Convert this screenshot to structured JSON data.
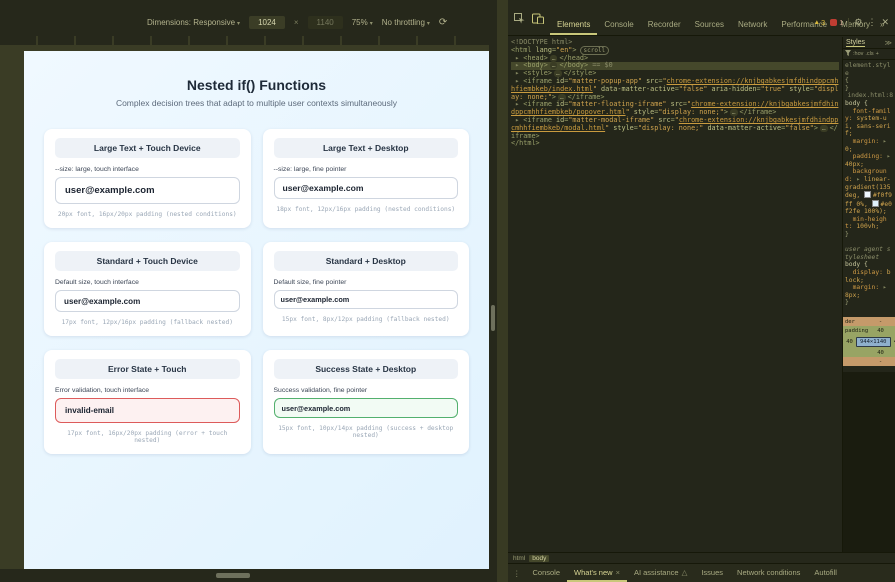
{
  "colors": {
    "page_gradient_start": "#f0f9ff",
    "page_gradient_end": "#e0f2fe",
    "error_red": "#dd5b5b",
    "success_green": "#53b06e",
    "devtools_accent": "#c9c77a"
  },
  "device_toolbar": {
    "dimensions_label": "Dimensions: Responsive",
    "caret": "▾",
    "width_value": "1024",
    "multiply": "×",
    "height_value": "1140",
    "zoom_value": "75%",
    "throttling_value": "No throttling",
    "rotate_glyph": "⟳"
  },
  "page": {
    "title": "Nested if() Functions",
    "subtitle": "Complex decision trees that adapt to multiple user contexts simultaneously",
    "cards": [
      {
        "header": "Large Text + Touch Device",
        "label": "--size: large, touch interface",
        "value": "user@example.com",
        "caption": "20px font, 16px/20px padding (nested conditions)"
      },
      {
        "header": "Large Text + Desktop",
        "label": "--size: large, fine pointer",
        "value": "user@example.com",
        "caption": "18px font, 12px/16px padding (nested conditions)"
      },
      {
        "header": "Standard + Touch Device",
        "label": "Default size, touch interface",
        "value": "user@example.com",
        "caption": "17px font, 12px/16px padding (fallback nested)"
      },
      {
        "header": "Standard + Desktop",
        "label": "Default size, fine pointer",
        "value": "user@example.com",
        "caption": "15px font, 8px/12px padding (fallback nested)"
      },
      {
        "header": "Error State + Touch",
        "label": "Error validation, touch interface",
        "value": "invalid-email",
        "caption": "17px font, 16px/20px padding (error + touch nested)"
      },
      {
        "header": "Success State + Desktop",
        "label": "Success validation, fine pointer",
        "value": "user@example.com",
        "caption": "15px font, 10px/14px padding (success + desktop nested)"
      }
    ]
  },
  "devtools": {
    "tabs": [
      "Elements",
      "Console",
      "Recorder",
      "Sources",
      "Network",
      "Performance",
      "Memory"
    ],
    "more_tabs": "»",
    "warn_glyph": "▲",
    "warning_count": "3",
    "error_count": "1",
    "gear": "⚙",
    "menu_dots": "⋮",
    "close": "✕",
    "dom_lines": [
      {
        "segs": [
          [
            "gray",
            "<!DOCTYPE html>"
          ]
        ]
      },
      {
        "segs": [
          [
            "tag",
            "<html"
          ],
          [
            "attr",
            " lang"
          ],
          [
            "tag",
            "="
          ],
          [
            "val",
            "\"en\""
          ],
          [
            "tag",
            ">"
          ],
          [
            "badge",
            "scroll"
          ]
        ]
      },
      {
        "segs": [
          [
            "arr",
            " ▸ "
          ],
          [
            "tag",
            "<head>"
          ],
          [
            "ell",
            "…"
          ],
          [
            "tag",
            "</head>"
          ]
        ]
      },
      {
        "sel": true,
        "segs": [
          [
            "arr",
            " ▸ "
          ],
          [
            "tag",
            "<body>"
          ],
          [
            "ell",
            "…"
          ],
          [
            "tag",
            "</body>"
          ],
          [
            "gray",
            " == $0"
          ]
        ]
      },
      {
        "segs": [
          [
            "arr",
            " ▸ "
          ],
          [
            "tag",
            "<style>"
          ],
          [
            "ell",
            "…"
          ],
          [
            "tag",
            "</style>"
          ]
        ]
      },
      {
        "segs": [
          [
            "arr",
            " ▸ "
          ],
          [
            "tag",
            "<iframe"
          ],
          [
            "attr",
            " id"
          ],
          [
            "tag",
            "="
          ],
          [
            "val",
            "\"matter-popup-app\""
          ],
          [
            "attr",
            " src"
          ],
          [
            "tag",
            "="
          ],
          [
            "val",
            "\""
          ],
          [
            "link",
            "chrome-extension://knjbgabkesjmfdhindppcmhhfiembkeb/index.html"
          ],
          [
            "val",
            "\""
          ],
          [
            "attr",
            " data-matter-active"
          ],
          [
            "tag",
            "="
          ],
          [
            "val",
            "\"false\""
          ],
          [
            "attr",
            " aria-hidden"
          ],
          [
            "tag",
            "="
          ],
          [
            "val",
            "\"true\""
          ],
          [
            "attr",
            " style"
          ],
          [
            "tag",
            "="
          ],
          [
            "val",
            "\"display: none;\""
          ],
          [
            "tag",
            ">"
          ],
          [
            "ell",
            "…"
          ],
          [
            "tag",
            "</iframe>"
          ]
        ]
      },
      {
        "segs": [
          [
            "arr",
            " ▸ "
          ],
          [
            "tag",
            "<iframe"
          ],
          [
            "attr",
            " id"
          ],
          [
            "tag",
            "="
          ],
          [
            "val",
            "\"matter-floating-iframe\""
          ],
          [
            "attr",
            " src"
          ],
          [
            "tag",
            "="
          ],
          [
            "val",
            "\""
          ],
          [
            "link",
            "chrome-extension://knjbgabkesjmfdhindppcmhhfiembkeb/popover.html"
          ],
          [
            "val",
            "\""
          ],
          [
            "attr",
            " style"
          ],
          [
            "tag",
            "="
          ],
          [
            "val",
            "\"display: none;\""
          ],
          [
            "tag",
            ">"
          ],
          [
            "ell",
            "…"
          ],
          [
            "tag",
            "</iframe>"
          ]
        ]
      },
      {
        "segs": [
          [
            "arr",
            " ▸ "
          ],
          [
            "tag",
            "<iframe"
          ],
          [
            "attr",
            " id"
          ],
          [
            "tag",
            "="
          ],
          [
            "val",
            "\"matter-modal-iframe\""
          ],
          [
            "attr",
            " src"
          ],
          [
            "tag",
            "="
          ],
          [
            "val",
            "\""
          ],
          [
            "link",
            "chrome-extension://knjbgabkesjmfdhindppcmhhfiembkeb/modal.html"
          ],
          [
            "val",
            "\""
          ],
          [
            "attr",
            " style"
          ],
          [
            "tag",
            "="
          ],
          [
            "val",
            "\"display: none;\""
          ],
          [
            "attr",
            " data-matter-active"
          ],
          [
            "tag",
            "="
          ],
          [
            "val",
            "\"false\""
          ],
          [
            "tag",
            ">"
          ],
          [
            "ell",
            "…"
          ],
          [
            "tag",
            "</iframe>"
          ]
        ]
      },
      {
        "segs": [
          [
            "tag",
            "</html>"
          ]
        ]
      }
    ],
    "styles_panel": {
      "title": "Styles",
      "more": "≫",
      "pseudo": ":hov",
      "cls": ".cls",
      "add": "+",
      "lines": [
        {
          "segs": [
            [
              "meta",
              "element.style"
            ]
          ]
        },
        {
          "segs": [
            [
              "pun",
              "{"
            ]
          ]
        },
        {
          "segs": [
            [
              "pun",
              "}"
            ]
          ]
        },
        {
          "segs": [
            [
              "rlink",
              "index.html:8"
            ]
          ]
        },
        {
          "segs": [
            [
              "sel",
              "body {"
            ]
          ]
        },
        {
          "segs": [
            [
              "prop",
              "  font-family:"
            ],
            [
              "val",
              " system-ui, sans-serif;"
            ]
          ]
        },
        {
          "segs": [
            [
              "prop",
              "  margin:"
            ],
            [
              "arr",
              " ▸"
            ],
            [
              "val",
              " 0;"
            ]
          ]
        },
        {
          "segs": [
            [
              "prop",
              "  padding:"
            ],
            [
              "arr",
              " ▸"
            ],
            [
              "val",
              " 40px;"
            ]
          ]
        },
        {
          "segs": [
            [
              "prop",
              "  background:"
            ],
            [
              "arr",
              " ▸"
            ],
            [
              "val",
              " linear-gradient(135deg, "
            ],
            [
              "swatch",
              "#f0f9ff"
            ],
            [
              "val",
              "#f0f9ff 0%, "
            ],
            [
              "swatch",
              "#e0f2fe"
            ],
            [
              "val",
              "#e0f2fe 100%);"
            ]
          ]
        },
        {
          "segs": [
            [
              "prop",
              "  min-height:"
            ],
            [
              "val",
              " 100vh;"
            ]
          ]
        },
        {
          "segs": [
            [
              "pun",
              "}"
            ]
          ]
        },
        {
          "segs": [
            [
              "sp",
              " "
            ]
          ]
        },
        {
          "segs": [
            [
              "metai",
              "user agent stylesheet"
            ]
          ]
        },
        {
          "segs": [
            [
              "sel",
              "body {"
            ]
          ]
        },
        {
          "segs": [
            [
              "prop",
              "  display:"
            ],
            [
              "val",
              " block;"
            ]
          ]
        },
        {
          "segs": [
            [
              "prop",
              "  margin:"
            ],
            [
              "arr",
              " ▸"
            ],
            [
              "val",
              " 8px;"
            ]
          ]
        },
        {
          "segs": [
            [
              "pun",
              "}"
            ]
          ]
        }
      ]
    },
    "box_model": {
      "border_label": "der",
      "dash": "-",
      "padding_label": "padding",
      "top": "40",
      "left": "40",
      "right": "40",
      "bottom": "40",
      "content": "944×1140",
      "bottom_dash": "-"
    },
    "breadcrumbs": [
      {
        "label": "html"
      },
      {
        "label": "body"
      }
    ],
    "drawer_tabs": [
      {
        "label": "Console"
      },
      {
        "label": "What's new",
        "close": "×"
      },
      {
        "label": "AI assistance",
        "badge": "△"
      },
      {
        "label": "Issues"
      },
      {
        "label": "Network conditions"
      },
      {
        "label": "Autofill"
      }
    ]
  }
}
